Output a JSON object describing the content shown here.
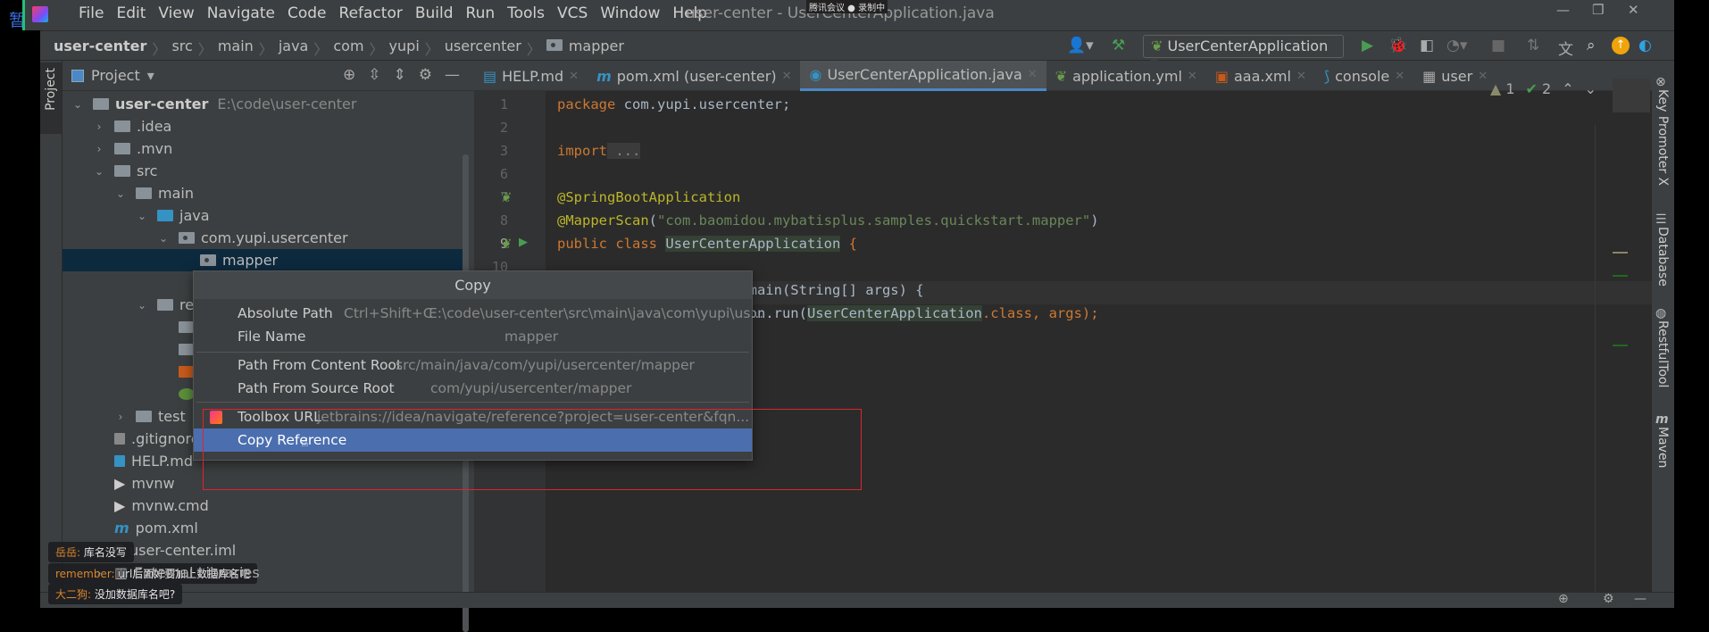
{
  "overlay_pause": "暂停",
  "titlebar": {
    "menu": [
      "File",
      "Edit",
      "View",
      "Navigate",
      "Code",
      "Refactor",
      "Build",
      "Run",
      "Tools",
      "VCS",
      "Window",
      "Help"
    ],
    "title": "user-center - UserCenterApplication.java",
    "meeting_status": "腾讯会议 ● 录制中",
    "controls": [
      "minimize-icon",
      "restore-icon",
      "close-icon"
    ]
  },
  "breadcrumb": [
    "user-center",
    "src",
    "main",
    "java",
    "com",
    "yupi",
    "usercenter",
    "mapper"
  ],
  "toolbar": {
    "run_config": "UserCenterApplication"
  },
  "project_panel": {
    "title": "Project",
    "tool_strip_label": "Project",
    "tree": [
      {
        "label": "user-center",
        "path": "E:\\code\\user-center",
        "depth": 0,
        "expanded": true,
        "bold": true
      },
      {
        "label": ".idea",
        "depth": 1,
        "expanded": false
      },
      {
        "label": ".mvn",
        "depth": 1,
        "expanded": false
      },
      {
        "label": "src",
        "depth": 1,
        "expanded": true
      },
      {
        "label": "main",
        "depth": 2,
        "expanded": true
      },
      {
        "label": "java",
        "depth": 3,
        "expanded": true
      },
      {
        "label": "com.yupi.usercenter",
        "depth": 4,
        "expanded": true
      },
      {
        "label": "mapper",
        "depth": 5,
        "selected": true
      },
      {
        "label": "resources",
        "depth": 3,
        "expanded": true
      },
      {
        "label": "test",
        "depth": 2,
        "expanded": false
      },
      {
        "label": ".gitignore",
        "depth": 1
      },
      {
        "label": "HELP.md",
        "depth": 1
      },
      {
        "label": "mvnw",
        "depth": 1
      },
      {
        "label": "mvnw.cmd",
        "depth": 1
      },
      {
        "label": "pom.xml",
        "depth": 1
      },
      {
        "label": "user-center.iml",
        "depth": 1
      },
      {
        "label": "External Libraries",
        "depth": 0
      }
    ]
  },
  "editor": {
    "tabs": [
      {
        "label": "HELP.md",
        "icon": "markdown-icon"
      },
      {
        "label": "pom.xml (user-center)",
        "icon": "maven-icon"
      },
      {
        "label": "UserCenterApplication.java",
        "icon": "spring-class-icon",
        "active": true
      },
      {
        "label": "application.yml",
        "icon": "spring-config-icon"
      },
      {
        "label": "aaa.xml",
        "icon": "xml-icon"
      },
      {
        "label": "console",
        "icon": "mysql-icon"
      },
      {
        "label": "user",
        "icon": "table-icon"
      }
    ],
    "inspections": {
      "warnings": "1",
      "weak_warnings": "2"
    },
    "line_numbers": [
      "1",
      "2",
      "3",
      "6",
      "7",
      "8",
      "9",
      "10"
    ],
    "code": {
      "l1_kw": "package",
      "l1_rest": " com.yupi.usercenter;",
      "l3_kw": "import",
      "l3_fold": " ...",
      "l7": "@SpringBootApplication",
      "l8_ann": "@MapperScan",
      "l8_str": "\"com.baomidou.mybatisplus.samples.quickstart.mapper\"",
      "l9_kw": "public class ",
      "l9_name": "UserCenterApplication",
      "l9_end": " {",
      "l11": "    public static void main(String[] args) {",
      "l12_pre": "        SpringApplication.run(",
      "l12_cls": "UserCenterApplication",
      "l12_end": ".class, args);"
    }
  },
  "right_tools": [
    "Key Promoter X",
    "Database",
    "RestfulTool",
    "Maven"
  ],
  "popup": {
    "title": "Copy",
    "items": [
      {
        "label": "Absolute Path",
        "shortcut": "Ctrl+Shift+C",
        "value": "E:\\code\\user-center\\src\\main\\java\\com\\yupi\\us..."
      },
      {
        "label": "File Name",
        "value": "mapper"
      },
      {
        "label": "Path From Content Root",
        "value": "src/main/java/com/yupi/usercenter/mapper"
      },
      {
        "label": "Path From Source Root",
        "value": "com/yupi/usercenter/mapper"
      },
      {
        "label": "Toolbox URL",
        "value": "jetbrains://idea/navigate/reference?project=user-center&fqn..."
      },
      {
        "label": "Copy Reference",
        "selected": true
      }
    ]
  },
  "chat": [
    {
      "user": "岳岳:",
      "msg": "库名没写"
    },
    {
      "user": "remember:",
      "msg": "url后面好要加上数据库名吧"
    },
    {
      "user": "大二狗:",
      "msg": "没加数据库名吧?"
    }
  ],
  "colors": {
    "accent": "#4b6eaf",
    "selection": "#0d293e",
    "annotation_box": "#e0242c"
  }
}
